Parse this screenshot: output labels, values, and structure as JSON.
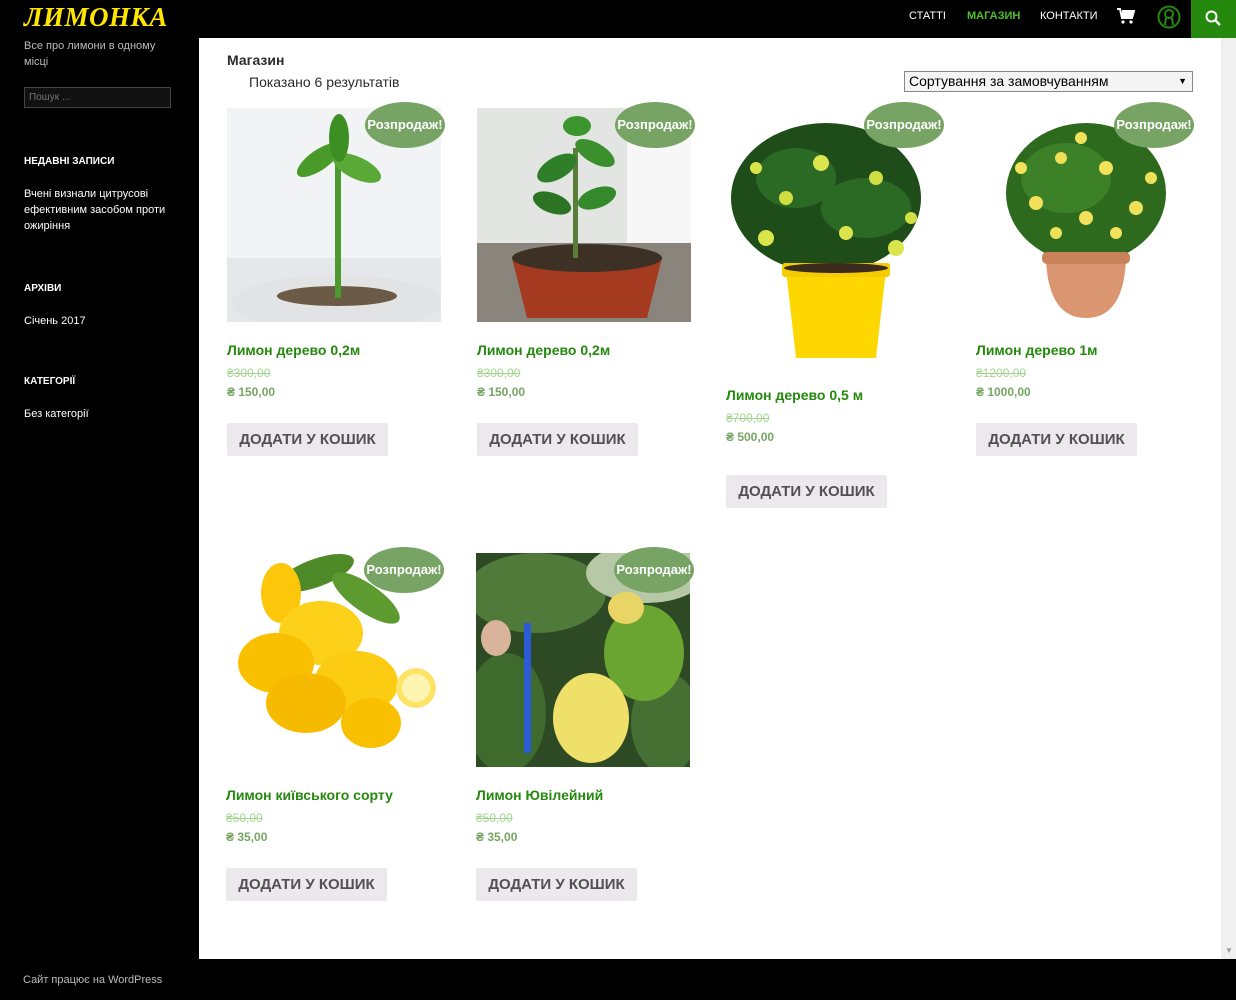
{
  "site": {
    "logo": "ЛИМОНКА",
    "tagline": "Все про лимони в одному місці",
    "search_placeholder": "Пошук ...",
    "footer": "Сайт працює на WordPress"
  },
  "colors": {
    "accent": "#24890d",
    "badge": "#77a464",
    "logo": "#ffe600"
  },
  "nav": {
    "items": [
      {
        "label": "Статті"
      },
      {
        "label": "Магазин"
      },
      {
        "label": "Контакти"
      }
    ],
    "icons": [
      "cart-icon",
      "user-icon",
      "search-icon"
    ]
  },
  "widgets": {
    "recent": {
      "title": "Недавні записи",
      "items": [
        "Вчені визнали цитрусові ефективним засобом проти ожиріння"
      ]
    },
    "archives": {
      "title": "Архіви",
      "items": [
        "Січень 2017"
      ]
    },
    "categories": {
      "title": "Категорії",
      "items": [
        "Без категорії"
      ]
    }
  },
  "shop": {
    "title": "Магазин",
    "result_count": "Показано 6 результатів",
    "sort": "Сортування за замовчуванням"
  },
  "products": [
    {
      "name": "Лимон дерево 0,2м",
      "old_price": "₴300,00",
      "price": "₴ 150,00",
      "badge": "Розпродаж!",
      "button": "Додати у кошик",
      "image": "lemon seedling in plastic cup"
    },
    {
      "name": "Лимон дерево 0,2м",
      "old_price": "₴300,00",
      "price": "₴ 150,00",
      "badge": "Розпродаж!",
      "button": "Додати у кошик",
      "image": "lemon sapling in brown pot"
    },
    {
      "name": "Лимон дерево 0,5 м",
      "old_price": "₴700,00",
      "price": "₴ 500,00",
      "badge": "Розпродаж!",
      "button": "Додати у кошик",
      "image": "lemon tree in yellow pot"
    },
    {
      "name": "Лимон дерево 1м",
      "old_price": "₴1200,00",
      "price": "₴ 1000,00",
      "badge": "Розпродаж!",
      "button": "Додати у кошик",
      "image": "lemon tree in terracotta pot"
    },
    {
      "name": "Лимон київського сорту",
      "old_price": "₴50,00",
      "price": "₴ 35,00",
      "badge": "Розпродаж!",
      "button": "Додати у кошик",
      "image": "pile of lemons"
    },
    {
      "name": "Лимон Ювілейний",
      "old_price": "₴50,00",
      "price": "₴ 35,00",
      "badge": "Розпродаж!",
      "button": "Додати у кошик",
      "image": "large lemons on branch"
    }
  ]
}
